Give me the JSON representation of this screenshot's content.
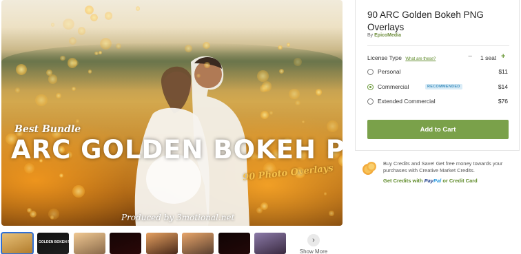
{
  "preview": {
    "tag_best": "Best Bundle",
    "tag_main": "ARC GOLDEN BOKEH PNG",
    "tag_sub": "90 Photo Overlays",
    "tag_credit": "Produced by 3motional.net"
  },
  "thumbnails": [
    {
      "label": "",
      "colors": [
        "#e8c27a",
        "#b07a2a"
      ]
    },
    {
      "label": "GOLDEN BOKEH PNG",
      "colors": [
        "#121212",
        "#1e1e1e"
      ]
    },
    {
      "label": "",
      "colors": [
        "#f0c892",
        "#8a6a4a"
      ]
    },
    {
      "label": "",
      "colors": [
        "#150505",
        "#2a0808"
      ]
    },
    {
      "label": "",
      "colors": [
        "#e5a060",
        "#4a2a1a"
      ]
    },
    {
      "label": "",
      "colors": [
        "#e8a56a",
        "#5a4030"
      ]
    },
    {
      "label": "",
      "colors": [
        "#100404",
        "#220808"
      ]
    },
    {
      "label": "",
      "colors": [
        "#8b7aa8",
        "#3a2a40"
      ]
    }
  ],
  "show_more": {
    "label": "Show More",
    "icon": "chevron-right-icon"
  },
  "product": {
    "title": "90 ARC Golden Bokeh PNG Overlays",
    "by_prefix": "By",
    "author": "EpicoMedia"
  },
  "license": {
    "label": "License Type",
    "help_link": "What are these?",
    "seat_minus": "−",
    "seat_value": "1 seat",
    "seat_plus": "+",
    "options": [
      {
        "name": "Personal",
        "price": "$11",
        "badge": "",
        "selected": false
      },
      {
        "name": "Commercial",
        "price": "$14",
        "badge": "RECOMMENDED",
        "selected": true
      },
      {
        "name": "Extended Commercial",
        "price": "$76",
        "badge": "",
        "selected": false
      }
    ]
  },
  "cart": {
    "label": "Add to Cart"
  },
  "credits": {
    "text": "Buy Credits and Save! Get free money towards your purchases with Creative Market Credits.",
    "link_prefix": "Get Credits with",
    "paypal_a": "Pay",
    "paypal_b": "Pal",
    "link_suffix": "or Credit Card"
  },
  "colors": {
    "accent_green": "#7aa14a",
    "link_green": "#5e8a28",
    "badge_blue": "#3b8dbd"
  }
}
